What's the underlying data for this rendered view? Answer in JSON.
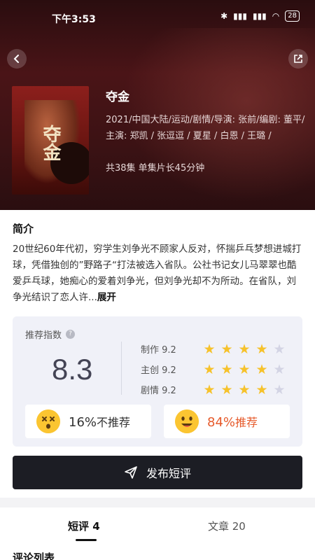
{
  "status_bar": {
    "time": "下午3:53",
    "battery": "28"
  },
  "drama": {
    "title": "夺金",
    "poster_title": "夺金",
    "meta": "2021/中国大陆/运动/剧情/导演: 张前/编剧: 董平/主演: 郑凯 / 张逗逗 / 夏星 / 白恩 / 王璐 /",
    "episodes": "共38集 单集片长45分钟"
  },
  "intro": {
    "heading": "简介",
    "text": "20世纪60年代初，穷学生刘争光不顾家人反对，怀揣乒乓梦想进城打球，凭借独创的”野路子“打法被选入省队。公社书记女儿马翠翠也酷爱乒乓球，她痴心的爱着刘争光，但刘争光却不为所动。在省队，刘争光结识了恋人许...",
    "expand": "展开"
  },
  "rating": {
    "label": "推荐指数",
    "help": "?",
    "score": "8.3",
    "sub_ratings": [
      {
        "label": "制作 9.2",
        "stars": 4
      },
      {
        "label": "主创 9.2",
        "stars": 4
      },
      {
        "label": "剧情 9.2",
        "stars": 4
      }
    ],
    "not_recommend": {
      "percent": "16%",
      "label": "不推荐"
    },
    "recommend": {
      "percent": "84%",
      "label": "推荐"
    }
  },
  "post_button": {
    "label": "发布短评"
  },
  "tabs": [
    {
      "label": "短评 4",
      "active": true
    },
    {
      "label": "文章 20",
      "active": false
    }
  ],
  "list_heading": "评论列表",
  "colors": {
    "accent": "#e65a2b",
    "star": "#f6c22b",
    "dark_button": "#1c1d24"
  }
}
